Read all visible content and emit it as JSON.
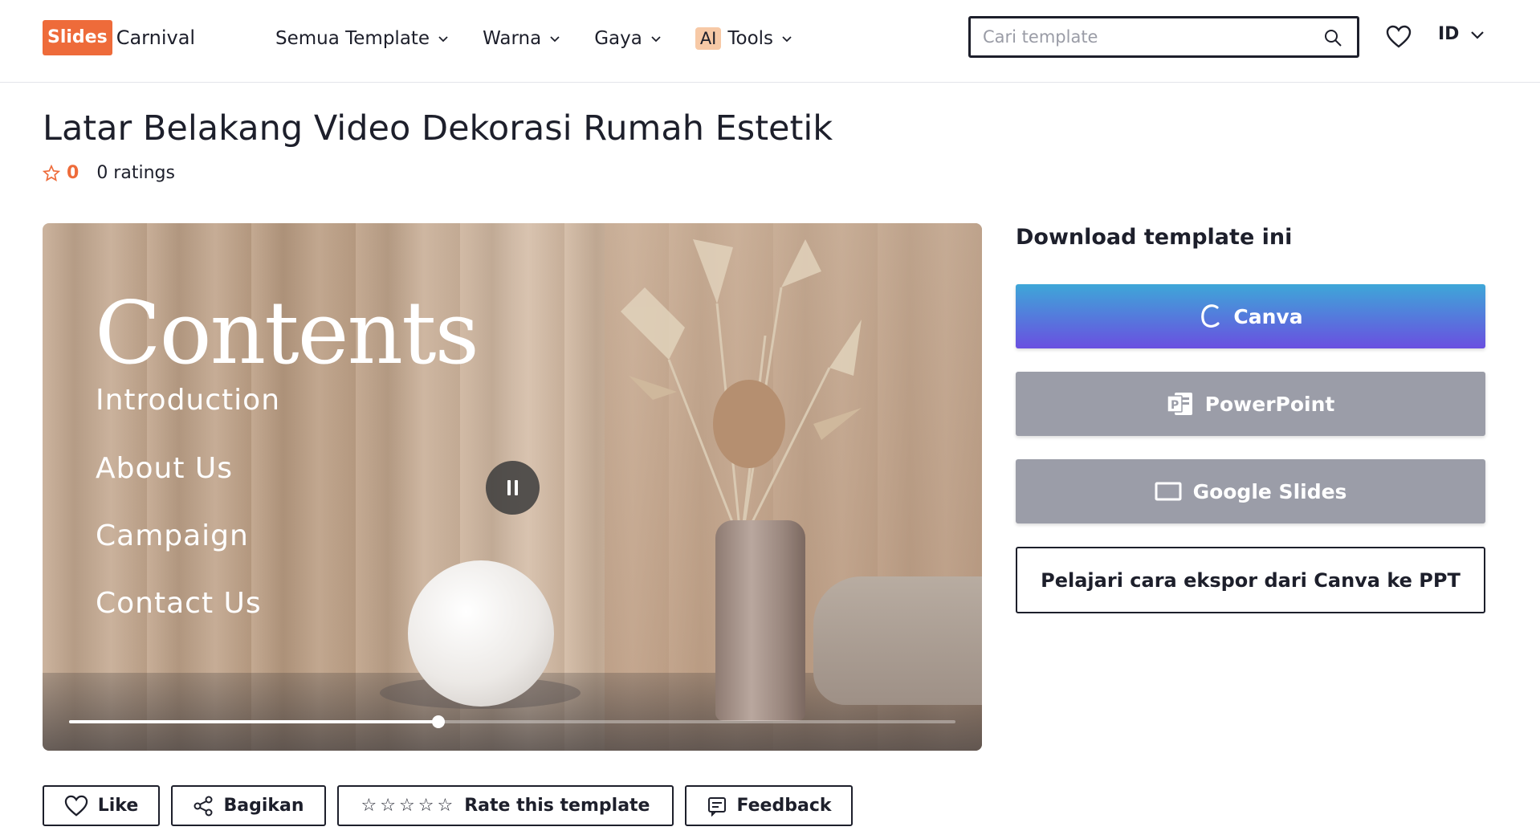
{
  "header": {
    "logo_box": "Slides",
    "logo_text": "Carnival",
    "nav": [
      {
        "label": "Semua Template"
      },
      {
        "label": "Warna"
      },
      {
        "label": "Gaya"
      },
      {
        "badge": "AI",
        "label": "Tools"
      }
    ],
    "search_placeholder": "Cari template",
    "language": "ID"
  },
  "page": {
    "title": "Latar Belakang Video Dekorasi Rumah Estetik",
    "rating_value": "0",
    "rating_count": "0 ratings"
  },
  "video": {
    "slide_title": "Contents",
    "menu_items": [
      "Introduction",
      "About Us",
      "Campaign",
      "Contact Us"
    ],
    "progress_fraction": 0.417
  },
  "download": {
    "heading": "Download template ini",
    "canva_label": "Canva",
    "powerpoint_label": "PowerPoint",
    "google_slides_label": "Google Slides",
    "learn_label": "Pelajari cara ekspor dari Canva ke PPT"
  },
  "actions": {
    "like_label": "Like",
    "share_label": "Bagikan",
    "rate_label": "Rate this template",
    "feedback_label": "Feedback"
  },
  "colors": {
    "accent_orange": "#ee6b3a",
    "canva_start": "#3ea7d8",
    "canva_end": "#6a4fe0",
    "disabled_gray": "#9b9da8",
    "text_dark": "#1d1f2b"
  }
}
